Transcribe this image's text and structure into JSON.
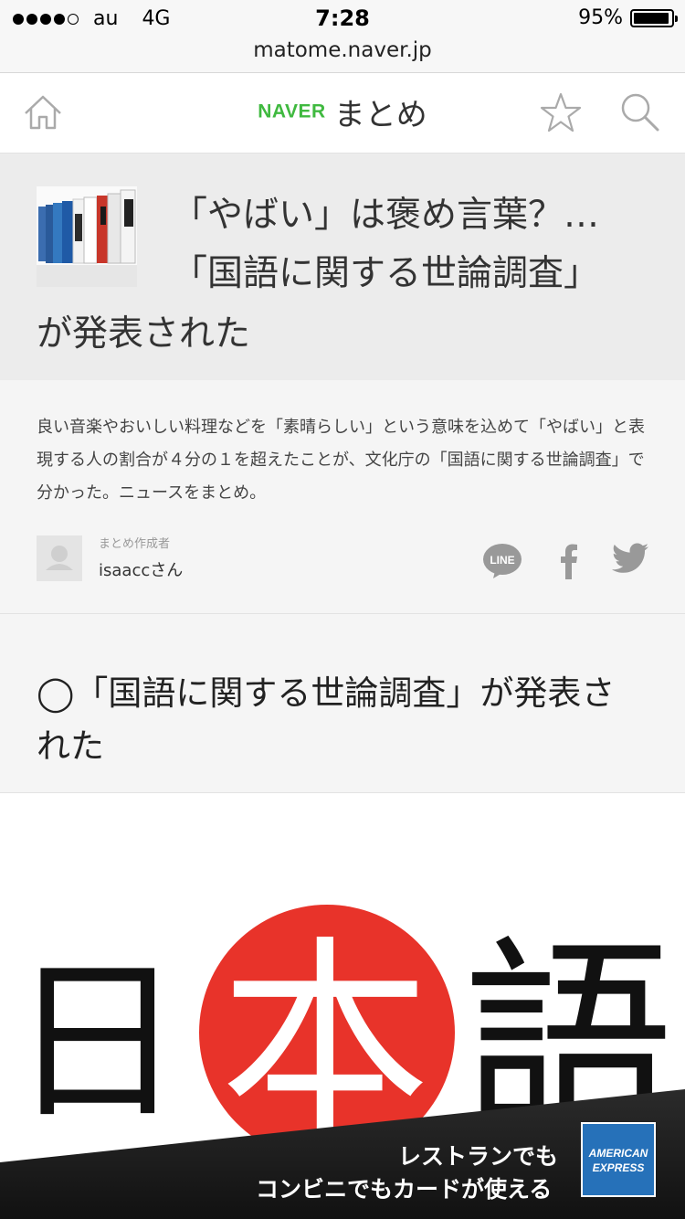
{
  "status_bar": {
    "carrier": "au",
    "network": "4G",
    "time": "7:28",
    "battery": "95%",
    "battery_level": 0.95,
    "signal_bars": 4
  },
  "browser": {
    "url": "matome.naver.jp"
  },
  "header": {
    "brand_naver": "NAVER",
    "brand_matome": "まとめ",
    "home_icon": "home-icon",
    "favorite_icon": "star-icon",
    "search_icon": "search-icon",
    "brand_color": "#3fb93f"
  },
  "article": {
    "title_line1": "「やばい」は褒め言葉？…",
    "title_line2": "「国語に関する世論調査」",
    "title_line3": "が発表された",
    "description": "良い音楽やおいしい料理などを「素晴らしい」という意味を込めて「やばい」と表現する人の割合が４分の１を超えたことが、文化庁の「国語に関する世論調査」で分かった。ニュースをまとめ。",
    "author_caption": "まとめ作成者",
    "author_name": "isaaccさん",
    "share": {
      "line_label": "LINE",
      "facebook_icon": "facebook-icon",
      "twitter_icon": "twitter-icon"
    }
  },
  "section": {
    "heading_line1": "◯「国語に関する世論調査」が発表さ",
    "heading_line2": "れた"
  },
  "main_image": {
    "char1": "日",
    "char2": "本",
    "char3": "語",
    "circle_color": "#e8332a"
  },
  "ad": {
    "line1": "レストランでも",
    "line2": "コンビニでもカードが使える",
    "logo_line1": "AMERICAN",
    "logo_line2": "EXPRESS",
    "logo_color": "#2671b9"
  }
}
